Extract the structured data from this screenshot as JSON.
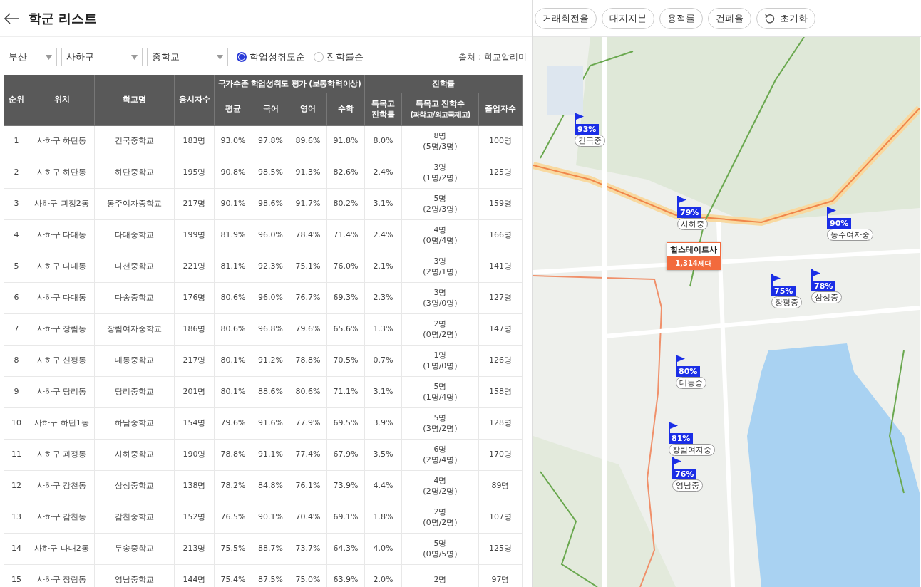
{
  "header": {
    "title": "학군 리스트"
  },
  "filters": {
    "dropdowns": [
      {
        "value": "부산"
      },
      {
        "value": "사하구"
      },
      {
        "value": "중학교"
      }
    ],
    "sort_options": [
      {
        "label": "학업성취도순",
        "selected": true
      },
      {
        "label": "진학률순",
        "selected": false
      }
    ],
    "source": "출처 : 학교알리미"
  },
  "table": {
    "columns": [
      {
        "label": "순위"
      },
      {
        "label": "위치"
      },
      {
        "label": "학교명"
      },
      {
        "label": "응시자수"
      }
    ],
    "groups": [
      {
        "label": "국가수준 학업성취도 평가 (보통학력이상)",
        "columns": [
          {
            "label": "평균"
          },
          {
            "label": "국어"
          },
          {
            "label": "영어"
          },
          {
            "label": "수학"
          }
        ]
      },
      {
        "label": "진학률",
        "columns": [
          {
            "label": "특목고 진학률"
          },
          {
            "label": "특목고 진학수",
            "note": "(과학고/외고국제고)"
          },
          {
            "label": "졸업자수"
          }
        ]
      }
    ],
    "rows": [
      {
        "rank": "1",
        "location": "사하구 하단동",
        "school": "건국중학교",
        "examinees": "183명",
        "avg": "93.0%",
        "korean": "97.8%",
        "english": "89.6%",
        "math": "91.8%",
        "rate": "8.0%",
        "admits": "8명",
        "admits_detail": "(5명/3명)",
        "graduates": "100명"
      },
      {
        "rank": "2",
        "location": "사하구 하단동",
        "school": "하단중학교",
        "examinees": "195명",
        "avg": "90.8%",
        "korean": "98.5%",
        "english": "91.3%",
        "math": "82.6%",
        "rate": "2.4%",
        "admits": "3명",
        "admits_detail": "(1명/2명)",
        "graduates": "125명"
      },
      {
        "rank": "3",
        "location": "사하구 괴정2동",
        "school": "동주여자중학교",
        "examinees": "217명",
        "avg": "90.1%",
        "korean": "98.6%",
        "english": "91.7%",
        "math": "80.2%",
        "rate": "3.1%",
        "admits": "5명",
        "admits_detail": "(2명/3명)",
        "graduates": "159명"
      },
      {
        "rank": "4",
        "location": "사하구 다대동",
        "school": "다대중학교",
        "examinees": "199명",
        "avg": "81.9%",
        "korean": "96.0%",
        "english": "78.4%",
        "math": "71.4%",
        "rate": "2.4%",
        "admits": "4명",
        "admits_detail": "(0명/4명)",
        "graduates": "166명"
      },
      {
        "rank": "5",
        "location": "사하구 다대동",
        "school": "다선중학교",
        "examinees": "221명",
        "avg": "81.1%",
        "korean": "92.3%",
        "english": "75.1%",
        "math": "76.0%",
        "rate": "2.1%",
        "admits": "3명",
        "admits_detail": "(2명/1명)",
        "graduates": "141명"
      },
      {
        "rank": "6",
        "location": "사하구 다대동",
        "school": "다송중학교",
        "examinees": "176명",
        "avg": "80.6%",
        "korean": "96.0%",
        "english": "76.7%",
        "math": "69.3%",
        "rate": "2.3%",
        "admits": "3명",
        "admits_detail": "(3명/0명)",
        "graduates": "127명"
      },
      {
        "rank": "7",
        "location": "사하구 장림동",
        "school": "장림여자중학교",
        "examinees": "186명",
        "avg": "80.6%",
        "korean": "96.8%",
        "english": "79.6%",
        "math": "65.6%",
        "rate": "1.3%",
        "admits": "2명",
        "admits_detail": "(0명/2명)",
        "graduates": "147명"
      },
      {
        "rank": "8",
        "location": "사하구 신평동",
        "school": "대동중학교",
        "examinees": "217명",
        "avg": "80.1%",
        "korean": "91.2%",
        "english": "78.8%",
        "math": "70.5%",
        "rate": "0.7%",
        "admits": "1명",
        "admits_detail": "(1명/0명)",
        "graduates": "126명"
      },
      {
        "rank": "9",
        "location": "사하구 당리동",
        "school": "당리중학교",
        "examinees": "201명",
        "avg": "80.1%",
        "korean": "88.6%",
        "english": "80.6%",
        "math": "71.1%",
        "rate": "3.1%",
        "admits": "5명",
        "admits_detail": "(1명/4명)",
        "graduates": "158명"
      },
      {
        "rank": "10",
        "location": "사하구 하단1동",
        "school": "하남중학교",
        "examinees": "154명",
        "avg": "79.6%",
        "korean": "91.6%",
        "english": "77.9%",
        "math": "69.5%",
        "rate": "3.9%",
        "admits": "5명",
        "admits_detail": "(3명/2명)",
        "graduates": "128명"
      },
      {
        "rank": "11",
        "location": "사하구 괴정동",
        "school": "사하중학교",
        "examinees": "190명",
        "avg": "78.8%",
        "korean": "91.1%",
        "english": "77.4%",
        "math": "67.9%",
        "rate": "3.5%",
        "admits": "6명",
        "admits_detail": "(2명/4명)",
        "graduates": "170명"
      },
      {
        "rank": "12",
        "location": "사하구 감천동",
        "school": "삼성중학교",
        "examinees": "138명",
        "avg": "78.2%",
        "korean": "84.8%",
        "english": "76.1%",
        "math": "73.9%",
        "rate": "4.4%",
        "admits": "4명",
        "admits_detail": "(2명/2명)",
        "graduates": "89명"
      },
      {
        "rank": "13",
        "location": "사하구 감천동",
        "school": "감천중학교",
        "examinees": "152명",
        "avg": "76.5%",
        "korean": "90.1%",
        "english": "70.4%",
        "math": "69.1%",
        "rate": "1.8%",
        "admits": "2명",
        "admits_detail": "(0명/2명)",
        "graduates": "107명"
      },
      {
        "rank": "14",
        "location": "사하구 다대2동",
        "school": "두송중학교",
        "examinees": "213명",
        "avg": "75.5%",
        "korean": "88.7%",
        "english": "73.7%",
        "math": "64.3%",
        "rate": "4.0%",
        "admits": "5명",
        "admits_detail": "(0명/5명)",
        "graduates": "125명"
      },
      {
        "rank": "15",
        "location": "사하구 장림동",
        "school": "영남중학교",
        "examinees": "144명",
        "avg": "75.4%",
        "korean": "87.5%",
        "english": "75.0%",
        "math": "63.9%",
        "rate": "2.0%",
        "admits": "2명",
        "graduates": "97명"
      }
    ]
  },
  "map": {
    "toolbar": [
      {
        "label": "거래회전율",
        "kind": "filter"
      },
      {
        "label": "대지지분",
        "kind": "filter"
      },
      {
        "label": "용적률",
        "kind": "filter"
      },
      {
        "label": "건폐율",
        "kind": "filter"
      },
      {
        "label": "초기화",
        "kind": "reset"
      }
    ],
    "markers": [
      {
        "rate": "93%",
        "name": "건국중"
      },
      {
        "rate": "79%",
        "name": "사하중"
      },
      {
        "rate": "90%",
        "name": "동주여자중"
      },
      {
        "rate": "75%",
        "name": "장평중"
      },
      {
        "rate": "78%",
        "name": "삼성중"
      },
      {
        "rate": "80%",
        "name": "대동중"
      },
      {
        "rate": "81%",
        "name": "장림여자중"
      },
      {
        "rate": "76%",
        "name": "영남중"
      }
    ],
    "popup": {
      "name": "힐스테이트사",
      "households": "1,314세대"
    }
  }
}
